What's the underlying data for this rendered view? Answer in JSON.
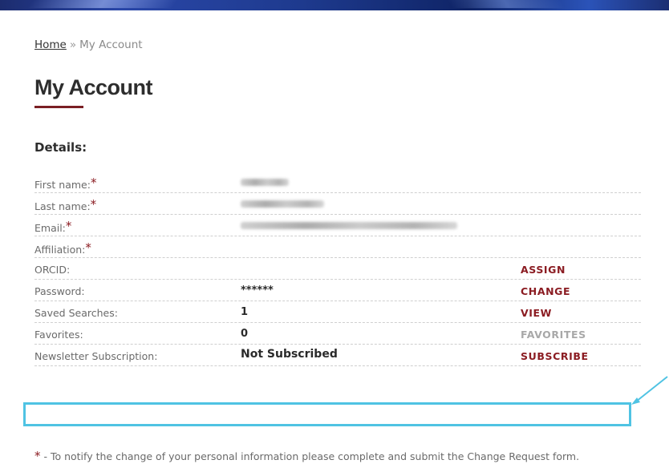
{
  "breadcrumb": {
    "home": "Home",
    "separator": "»",
    "current": "My Account"
  },
  "page_title": "My Account",
  "section_heading": "Details:",
  "required_mark": "*",
  "rows": [
    {
      "label": "First name:",
      "required": true,
      "value": "",
      "action": ""
    },
    {
      "label": "Last name:",
      "required": true,
      "value": "",
      "action": ""
    },
    {
      "label": "Email:",
      "required": true,
      "value": "",
      "action": ""
    },
    {
      "label": "Affiliation:",
      "required": true,
      "value": "",
      "action": ""
    },
    {
      "label": "ORCID:",
      "required": false,
      "value": "",
      "action": "ASSIGN"
    },
    {
      "label": "Password:",
      "required": false,
      "value": "******",
      "action": "CHANGE"
    },
    {
      "label": "Saved Searches:",
      "required": false,
      "value": "1",
      "action": "VIEW"
    },
    {
      "label": "Favorites:",
      "required": false,
      "value": "0",
      "action": "FAVORITES"
    },
    {
      "label": "Newsletter Subscription:",
      "required": false,
      "value": "Not Subscribed",
      "action": "SUBSCRIBE"
    }
  ],
  "footnote": {
    "mark": "*",
    "text": " - To notify the change of your personal information please complete and submit the Change Request form."
  },
  "colors": {
    "accent": "#8b1c22",
    "highlight": "#4fc3e3",
    "disabled_action": "#a8a8a8"
  }
}
